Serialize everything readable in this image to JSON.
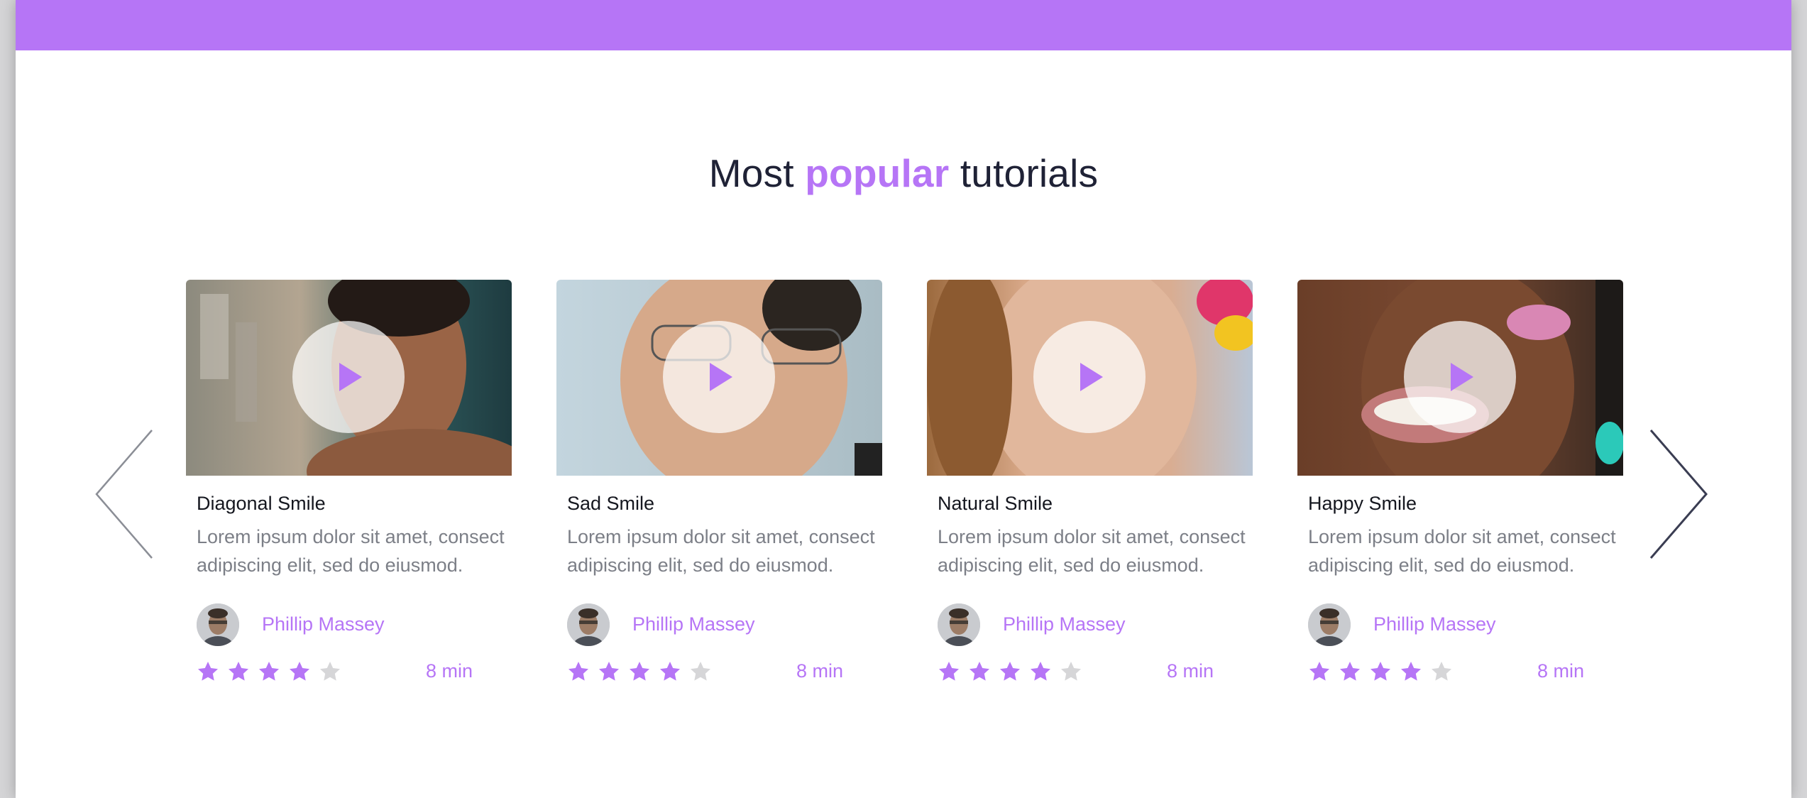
{
  "colors": {
    "accent": "#b675f6",
    "text_dark": "#15171f",
    "text_muted": "#7c7f87",
    "star_empty": "#d6d6d8"
  },
  "section": {
    "heading_before": "Most",
    "heading_accent": "popular",
    "heading_after": "tutorials"
  },
  "carousel": {
    "prev_icon": "chevron-left-icon",
    "next_icon": "chevron-right-icon",
    "cards": [
      {
        "title": "Diagonal Smile",
        "description": "Lorem ipsum dolor sit amet, consect adipiscing elit, sed do eiusmod.",
        "author": "Phillip Massey",
        "rating": 4,
        "rating_max": 5,
        "duration": "8 min"
      },
      {
        "title": "Sad Smile",
        "description": "Lorem ipsum dolor sit amet, consect adipiscing elit, sed do eiusmod.",
        "author": "Phillip Massey",
        "rating": 4,
        "rating_max": 5,
        "duration": "8 min"
      },
      {
        "title": "Natural Smile",
        "description": "Lorem ipsum dolor sit amet, consect adipiscing elit, sed do eiusmod.",
        "author": "Phillip Massey",
        "rating": 4,
        "rating_max": 5,
        "duration": "8 min"
      },
      {
        "title": "Happy Smile",
        "description": "Lorem ipsum dolor sit amet, consect adipiscing elit, sed do eiusmod.",
        "author": "Phillip Massey",
        "rating": 4,
        "rating_max": 5,
        "duration": "8 min"
      }
    ]
  }
}
